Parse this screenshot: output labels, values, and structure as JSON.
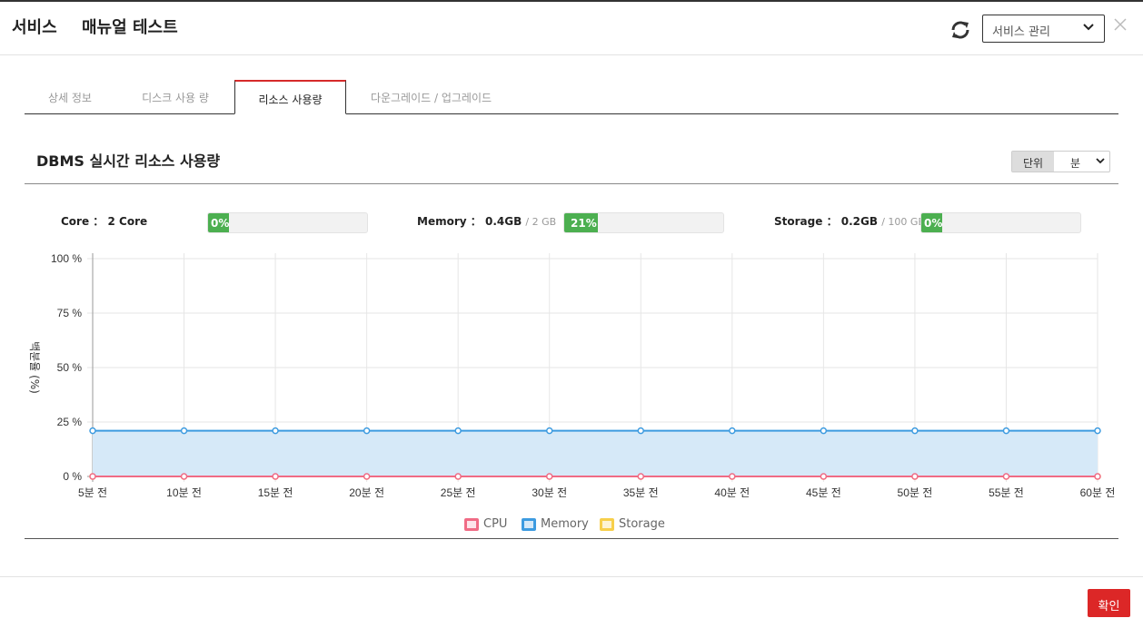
{
  "header": {
    "title": "서비스",
    "subtitle": "매뉴얼 테스트",
    "service_select": "서비스 관리"
  },
  "tabs": [
    {
      "label": "상세 정보",
      "active": false
    },
    {
      "label": "디스크 사용 량",
      "active": false
    },
    {
      "label": "리소스 사용량",
      "active": true
    },
    {
      "label": "다운그레이드 / 업그레이드",
      "active": false
    }
  ],
  "section": {
    "title": "DBMS 실시간 리소스 사용량",
    "unit_label": "단위",
    "unit_value": "분"
  },
  "resources": [
    {
      "label": "Core",
      "sep": "：",
      "value": "2 Core",
      "total": "",
      "percent": 0,
      "percent_text": "0%"
    },
    {
      "label": "Memory",
      "sep": "：",
      "value": "0.4GB",
      "total": "2 GB",
      "percent": 21,
      "percent_text": "21%"
    },
    {
      "label": "Storage",
      "sep": "：",
      "value": "0.2GB",
      "total": "100 GB",
      "percent": 0,
      "percent_text": "0%"
    }
  ],
  "colors": {
    "cpu": "#f06b85",
    "memory": "#3d9be0",
    "memory_fill": "#d6e9f8",
    "storage": "#f7cf4a",
    "bar_fill": "#4caf50",
    "accent_red": "#dc2727"
  },
  "chart_data": {
    "type": "line",
    "ylabel": "백분율 (%)",
    "xlabel": "",
    "ylim": [
      0,
      100
    ],
    "y_ticks": [
      "100 %",
      "75 %",
      "50 %",
      "25 %",
      "0 %"
    ],
    "y_tick_values": [
      100,
      75,
      50,
      25,
      0
    ],
    "categories": [
      "5분 전",
      "10분 전",
      "15분 전",
      "20분 전",
      "25분 전",
      "30분 전",
      "35분 전",
      "40분 전",
      "45분 전",
      "50분 전",
      "55분 전",
      "60분 전"
    ],
    "series": [
      {
        "name": "CPU",
        "values": [
          0,
          0,
          0,
          0,
          0,
          0,
          0,
          0,
          0,
          0,
          0,
          0
        ]
      },
      {
        "name": "Memory",
        "values": [
          21,
          21,
          21,
          21,
          21,
          21,
          21,
          21,
          21,
          21,
          21,
          21
        ]
      },
      {
        "name": "Storage",
        "values": [
          0,
          0,
          0,
          0,
          0,
          0,
          0,
          0,
          0,
          0,
          0,
          0
        ]
      }
    ],
    "grid": true,
    "legend": "bottom"
  },
  "footer": {
    "ok_label": "확인"
  }
}
